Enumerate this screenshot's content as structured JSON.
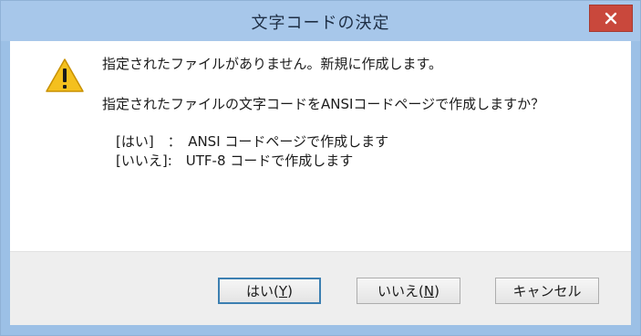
{
  "dialog": {
    "title": "文字コードの決定",
    "close_icon": "close-icon",
    "warning_icon": "warning-icon",
    "message_line1": "指定されたファイルがありません。新規に作成します。",
    "message_line2": "指定されたファイルの文字コードをANSIコードページで作成しますか？",
    "option_yes": "[はい]　：　ANSI コードページで作成します",
    "option_no": "[いいえ]:　UTF-8 コードで作成します",
    "colors": {
      "titlebar": "#a7c7ea",
      "close": "#c9483c",
      "warning": "#f4c01e"
    }
  },
  "buttons": {
    "yes_label": "はい(",
    "yes_key": "Y",
    "yes_suffix": ")",
    "no_label": "いいえ(",
    "no_key": "N",
    "no_suffix": ")",
    "cancel_label": "キャンセル"
  }
}
